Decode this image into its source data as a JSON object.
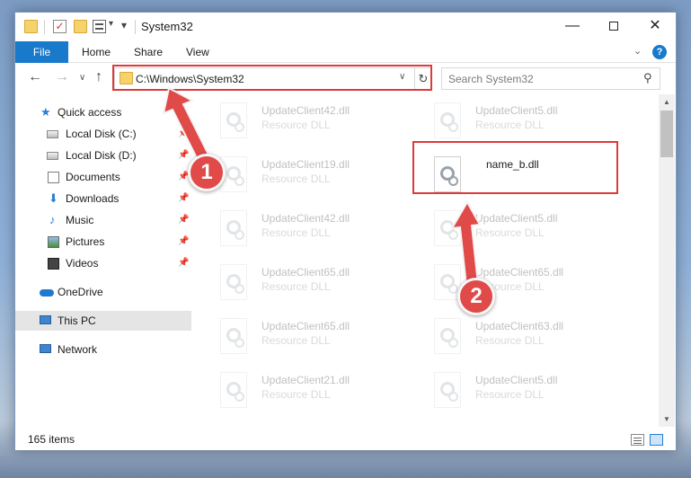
{
  "window": {
    "title": "System32",
    "controls": {
      "minimize": "—",
      "maximize": "",
      "close": "✕"
    }
  },
  "ribbon": {
    "tabs": [
      {
        "label": "File",
        "active": true
      },
      {
        "label": "Home"
      },
      {
        "label": "Share"
      },
      {
        "label": "View"
      }
    ],
    "help_label": "?",
    "chevron": "⌄"
  },
  "navigation": {
    "back": "←",
    "forward": "→",
    "recent": "∨",
    "up": "↑",
    "address": "C:\\Windows\\System32",
    "address_dropdown": "∨",
    "refresh": "↻",
    "search_placeholder": "Search System32",
    "search_icon": "⚲"
  },
  "sidebar": {
    "items": [
      {
        "label": "Quick access",
        "icon": "star-icon",
        "pinned": false
      },
      {
        "label": "Local Disk (C:)",
        "icon": "disk-icon",
        "pinned": true
      },
      {
        "label": "Local Disk (D:)",
        "icon": "disk-icon",
        "pinned": true
      },
      {
        "label": "Documents",
        "icon": "document-icon",
        "pinned": true
      },
      {
        "label": "Downloads",
        "icon": "download-icon",
        "pinned": true
      },
      {
        "label": "Music",
        "icon": "music-icon",
        "pinned": true
      },
      {
        "label": "Pictures",
        "icon": "pictures-icon",
        "pinned": true
      },
      {
        "label": "Videos",
        "icon": "videos-icon",
        "pinned": true
      },
      {
        "label": "OneDrive",
        "icon": "cloud-icon",
        "pinned": false
      },
      {
        "label": "This PC",
        "icon": "computer-icon",
        "pinned": false,
        "selected": true
      },
      {
        "label": "Network",
        "icon": "network-icon",
        "pinned": false
      }
    ],
    "pin_glyph": "📌"
  },
  "files": {
    "items": [
      {
        "name": "UpdateClient42.dll",
        "type": "Resource DLL",
        "faded": true
      },
      {
        "name": "UpdateClient5.dll",
        "type": "Resource DLL",
        "faded": true
      },
      {
        "name": "UpdateClient19.dll",
        "type": "Resource DLL",
        "faded": true
      },
      {
        "name": "name_b.dll",
        "type": "",
        "faded": false,
        "highlighted": true
      },
      {
        "name": "UpdateClient42.dll",
        "type": "Resource DLL",
        "faded": true
      },
      {
        "name": "UpdateClient5.dll",
        "type": "Resource DLL",
        "faded": true
      },
      {
        "name": "UpdateClient65.dll",
        "type": "Resource DLL",
        "faded": true
      },
      {
        "name": "UpdateClient65.dll",
        "type": "Resource DLL",
        "faded": true
      },
      {
        "name": "UpdateClient65.dll",
        "type": "Resource DLL",
        "faded": true
      },
      {
        "name": "UpdateClient63.dll",
        "type": "Resource DLL",
        "faded": true
      },
      {
        "name": "UpdateClient21.dll",
        "type": "Resource DLL",
        "faded": true
      },
      {
        "name": "UpdateClient5.dll",
        "type": "Resource DLL",
        "faded": true
      }
    ]
  },
  "status": {
    "item_count": "165 items"
  },
  "annotations": {
    "callout_1": "1",
    "callout_2": "2",
    "highlight_color": "#dd3a3a",
    "callout_color": "#e04a48"
  },
  "colors": {
    "accent": "#1979ca",
    "selected_bg": "#e5e5e5"
  }
}
